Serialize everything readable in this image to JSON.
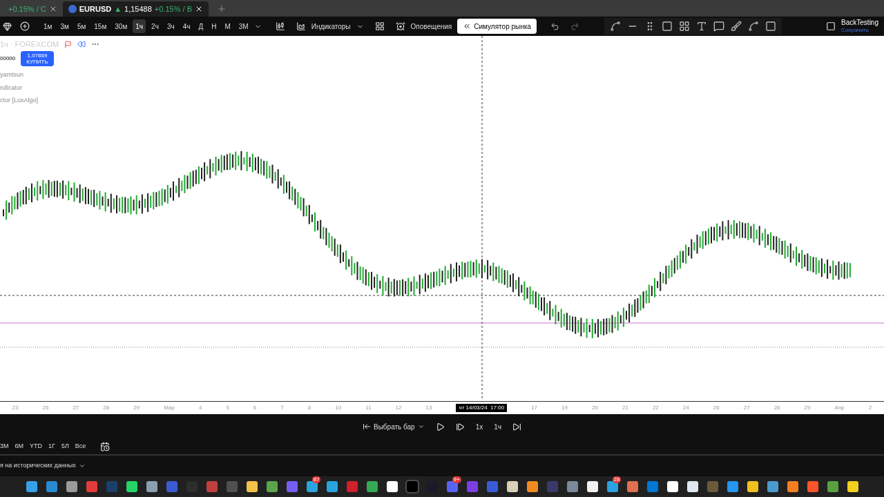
{
  "tabs": [
    {
      "label": "+0.15% / C",
      "selected": false
    },
    {
      "label": "EURUSD",
      "arrow": "▲",
      "price": "1,15488",
      "change": "+0.15% / B",
      "selected": true
    }
  ],
  "timeframes": [
    {
      "label": "1м",
      "selected": false
    },
    {
      "label": "3м",
      "selected": false
    },
    {
      "label": "5м",
      "selected": false
    },
    {
      "label": "15м",
      "selected": false
    },
    {
      "label": "30м",
      "selected": false
    },
    {
      "label": "1ч",
      "selected": true
    },
    {
      "label": "2ч",
      "selected": false
    },
    {
      "label": "3ч",
      "selected": false
    },
    {
      "label": "4ч",
      "selected": false
    },
    {
      "label": "Д",
      "selected": false
    },
    {
      "label": "Н",
      "selected": false
    },
    {
      "label": "М",
      "selected": false
    },
    {
      "label": "3М",
      "selected": false
    }
  ],
  "toolbar": {
    "indicators": "Индикаторы",
    "alerts": "Оповещения",
    "replay": "Симулятор рынка",
    "layout_name": "BackTesting",
    "layout_status": "Сохранить"
  },
  "legend": {
    "symbol": "1ч · FOREXCOM",
    "left_value": "00000",
    "price": "1,07869",
    "action": "КУПИТЬ",
    "indicators": [
      "yamtsun",
      "ndicator",
      "ctor [LuxAlgo]"
    ]
  },
  "x_axis": {
    "labels": [
      {
        "kind": "tick",
        "text": "23"
      },
      {
        "kind": "tick",
        "text": "26"
      },
      {
        "kind": "tick",
        "text": "27"
      },
      {
        "kind": "tick",
        "text": "28"
      },
      {
        "kind": "tick",
        "text": "29"
      },
      {
        "kind": "tick",
        "text": "Мар"
      },
      {
        "kind": "tick",
        "text": "4"
      },
      {
        "kind": "tick",
        "text": "5"
      },
      {
        "kind": "tick",
        "text": "6"
      },
      {
        "kind": "tick",
        "text": "7"
      },
      {
        "kind": "tick",
        "text": "8"
      },
      {
        "kind": "tick",
        "text": "10"
      },
      {
        "kind": "tick",
        "text": "11"
      },
      {
        "kind": "tick",
        "text": "12"
      },
      {
        "kind": "tick",
        "text": "13"
      },
      {
        "kind": "crosshair",
        "text": "чт 14/03/24  17:00"
      },
      {
        "kind": "tick",
        "text": "17"
      },
      {
        "kind": "tick",
        "text": "19"
      },
      {
        "kind": "tick",
        "text": "20"
      },
      {
        "kind": "tick",
        "text": "21"
      },
      {
        "kind": "tick",
        "text": "22"
      },
      {
        "kind": "tick",
        "text": "24"
      },
      {
        "kind": "tick",
        "text": "26"
      },
      {
        "kind": "tick",
        "text": "27"
      },
      {
        "kind": "tick",
        "text": "28"
      },
      {
        "kind": "tick",
        "text": "29"
      },
      {
        "kind": "tick",
        "text": "Апр"
      },
      {
        "kind": "tick",
        "text": "2"
      }
    ]
  },
  "replay_bar": {
    "select_bar": "Выбрать бар",
    "speed": "1x",
    "interval": "1ч"
  },
  "ranges": [
    "3М",
    "6М",
    "YTD",
    "1Г",
    "5Л",
    "Все"
  ],
  "status": "я на исторических данных",
  "taskbar": [
    {
      "color": "#38a0e8"
    },
    {
      "color": "#2a8cd0"
    },
    {
      "color": "#9a9a9a"
    },
    {
      "color": "#e23b3b"
    },
    {
      "color": "#1b3f6b"
    },
    {
      "color": "#25d366"
    },
    {
      "color": "#8aa0b0"
    },
    {
      "color": "#3b5bd0"
    },
    {
      "color": "#2d2d2d"
    },
    {
      "color": "#c04040"
    },
    {
      "color": "#505050"
    },
    {
      "color": "#f2c14a"
    },
    {
      "color": "#5aa54a"
    },
    {
      "color": "#7360f2"
    },
    {
      "color": "#2aa3e0",
      "badge": "87"
    },
    {
      "color": "#2aa3e0"
    },
    {
      "color": "#d0202a"
    },
    {
      "color": "#34a853"
    },
    {
      "color": "#ffffff"
    },
    {
      "color": "#000000",
      "selected": true
    },
    {
      "color": "#1a1a2a"
    },
    {
      "color": "#5865f2",
      "badge": "9+"
    },
    {
      "color": "#7b3fe4"
    },
    {
      "color": "#3a5bd8"
    },
    {
      "color": "#d8d0b8"
    },
    {
      "color": "#f08a20"
    },
    {
      "color": "#3a3a6a"
    },
    {
      "color": "#7a8a9a"
    },
    {
      "color": "#f0f0f0"
    },
    {
      "color": "#2aa3e0",
      "badge": "28"
    },
    {
      "color": "#e07050"
    },
    {
      "color": "#0078d4"
    },
    {
      "color": "#ffffff"
    },
    {
      "color": "#dfe8f0"
    },
    {
      "color": "#6a5a3a"
    },
    {
      "color": "#2496ed"
    },
    {
      "color": "#f0c020"
    },
    {
      "color": "#4a9ad0"
    },
    {
      "color": "#f38020"
    },
    {
      "color": "#fb542b"
    },
    {
      "color": "#5aa040"
    },
    {
      "color": "#f0d020"
    }
  ]
}
